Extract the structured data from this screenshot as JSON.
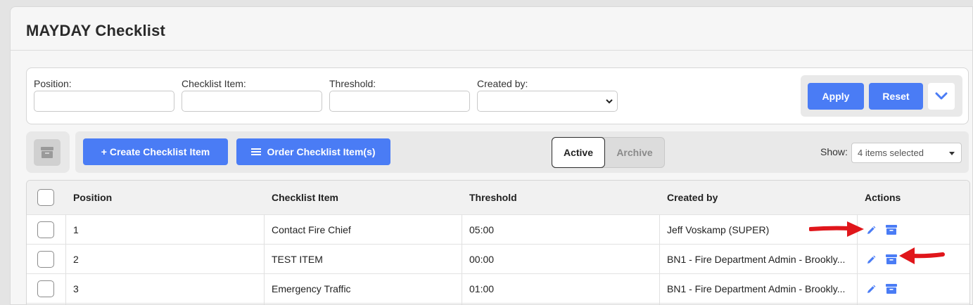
{
  "page": {
    "title": "MAYDAY Checklist"
  },
  "filters": {
    "position_label": "Position:",
    "position_value": "",
    "item_label": "Checklist Item:",
    "item_value": "",
    "threshold_label": "Threshold:",
    "threshold_value": "",
    "created_by_label": "Created by:",
    "created_by_value": "",
    "apply_label": "Apply",
    "reset_label": "Reset",
    "expand_icon": "chevron-down-icon"
  },
  "toolbar": {
    "archive_icon": "archive-icon",
    "create_label": "+ Create Checklist Item",
    "order_label": "Order Checklist Item(s)",
    "toggle_active": "Active",
    "toggle_archive": "Archive",
    "show_label": "Show:",
    "show_value": "4 items selected"
  },
  "table": {
    "headers": [
      "Position",
      "Checklist Item",
      "Threshold",
      "Created by",
      "Actions"
    ],
    "rows": [
      {
        "position": "1",
        "item": "Contact Fire Chief",
        "threshold": "05:00",
        "created_by": "Jeff Voskamp (SUPER)"
      },
      {
        "position": "2",
        "item": "TEST ITEM",
        "threshold": "00:00",
        "created_by": "BN1 - Fire Department Admin - Brookly..."
      },
      {
        "position": "3",
        "item": "Emergency Traffic",
        "threshold": "01:00",
        "created_by": "BN1 - Fire Department Admin - Brookly..."
      }
    ]
  },
  "colors": {
    "accent": "#4a7cf5",
    "annotation_arrow": "#e0161b"
  }
}
